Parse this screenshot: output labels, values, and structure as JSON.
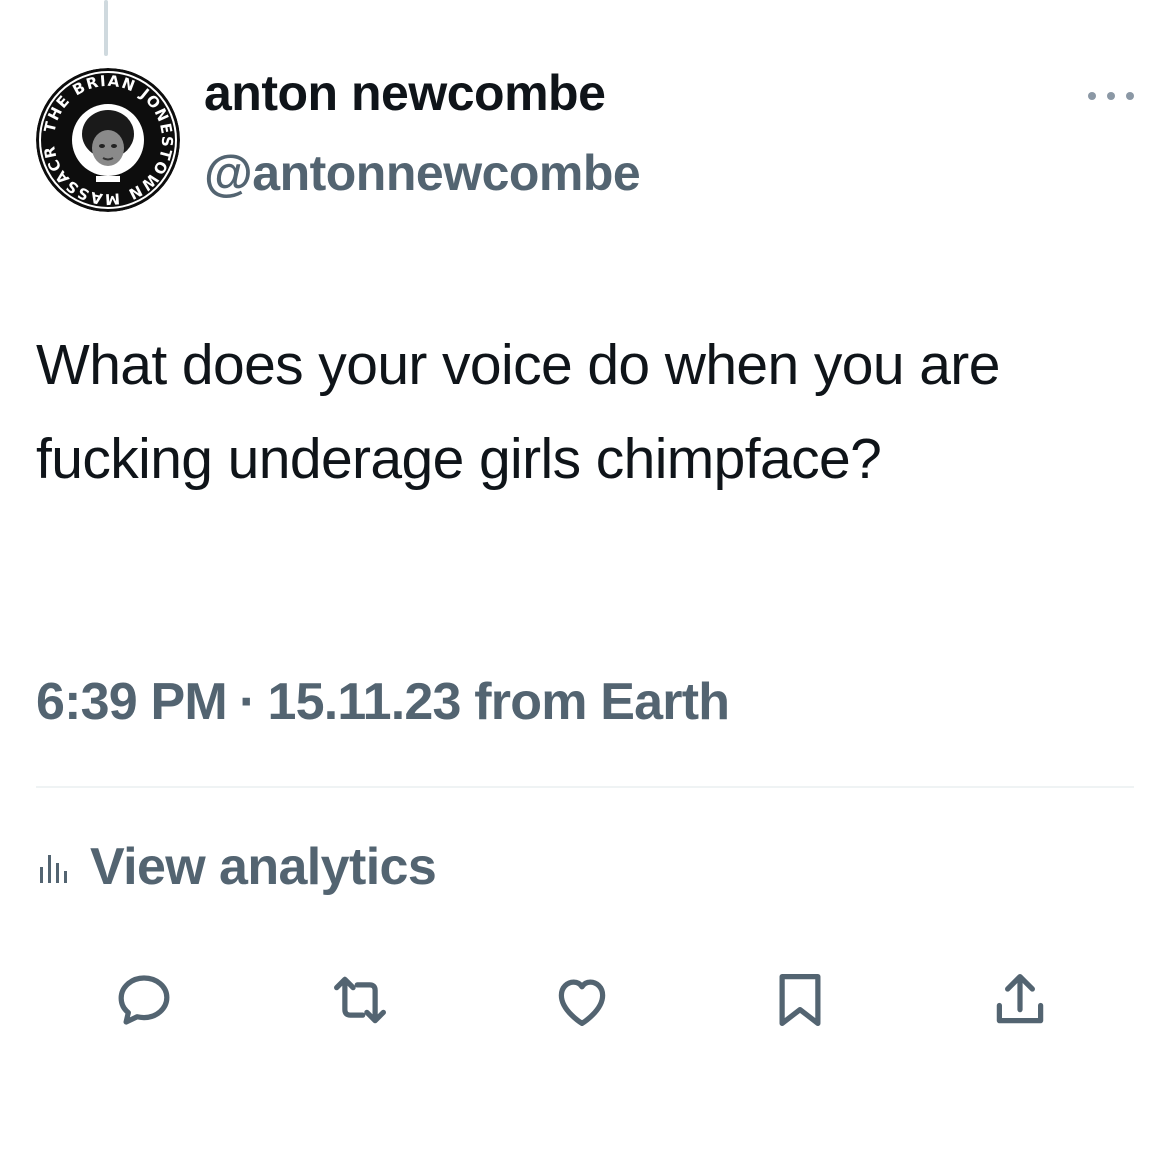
{
  "author": {
    "display_name": "anton newcombe",
    "handle": "@antonnewcombe",
    "avatar_icon": "band-logo-avatar",
    "avatar_text": "THE BRIAN JONESTOWN MASSACRE"
  },
  "tweet": {
    "text": "What does your voice do when you are fucking underage girls chimpface?",
    "time": "6:39 PM",
    "separator": "·",
    "date": "15.11.23",
    "source": "from Earth"
  },
  "analytics": {
    "label": "View analytics",
    "icon": "bar-chart-icon"
  },
  "actions": [
    {
      "name": "reply",
      "icon": "reply-icon"
    },
    {
      "name": "retweet",
      "icon": "retweet-icon"
    },
    {
      "name": "like",
      "icon": "heart-icon"
    },
    {
      "name": "bookmark",
      "icon": "bookmark-icon"
    },
    {
      "name": "share",
      "icon": "share-icon"
    }
  ],
  "colors": {
    "primary_text": "#0f1419",
    "secondary_text": "#536471",
    "divider": "#eff3f4"
  }
}
